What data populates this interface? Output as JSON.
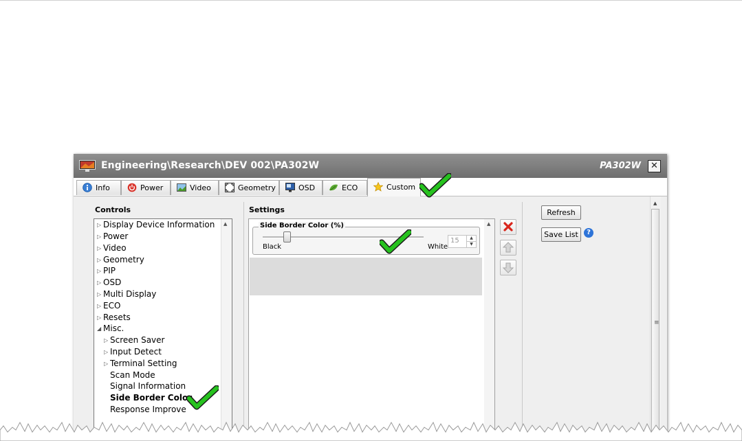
{
  "window": {
    "title": "Engineering\\Research\\DEV 002\\PA302W",
    "model": "PA302W",
    "close_glyph": "✕"
  },
  "tabs": [
    {
      "label": "Info",
      "icon": "info-icon"
    },
    {
      "label": "Power",
      "icon": "power-icon"
    },
    {
      "label": "Video",
      "icon": "video-icon"
    },
    {
      "label": "Geometry",
      "icon": "geometry-icon"
    },
    {
      "label": "OSD",
      "icon": "osd-icon"
    },
    {
      "label": "ECO",
      "icon": "eco-leaf-icon"
    },
    {
      "label": "Custom",
      "icon": "star-icon",
      "active": true
    }
  ],
  "controls": {
    "heading": "Controls",
    "items": [
      {
        "label": "Display Device Information",
        "expander": "collapsed"
      },
      {
        "label": "Power",
        "expander": "collapsed"
      },
      {
        "label": "Video",
        "expander": "collapsed"
      },
      {
        "label": "Geometry",
        "expander": "collapsed"
      },
      {
        "label": "PIP",
        "expander": "collapsed"
      },
      {
        "label": "OSD",
        "expander": "collapsed"
      },
      {
        "label": "Multi Display",
        "expander": "collapsed"
      },
      {
        "label": "ECO",
        "expander": "collapsed"
      },
      {
        "label": "Resets",
        "expander": "collapsed"
      },
      {
        "label": "Misc.",
        "expander": "expanded"
      },
      {
        "label": "Screen Saver",
        "expander": "collapsed",
        "child": true
      },
      {
        "label": "Input Detect",
        "expander": "collapsed",
        "child": true
      },
      {
        "label": "Terminal Setting",
        "expander": "collapsed",
        "child": true
      },
      {
        "label": "Scan Mode",
        "child": true
      },
      {
        "label": "Signal Information",
        "child": true
      },
      {
        "label": "Side Border Color",
        "child": true,
        "selected": true
      },
      {
        "label": "Response Improve",
        "child": true
      }
    ]
  },
  "settings": {
    "heading": "Settings",
    "setting_title": "Side Border Color (%)",
    "min_label": "Black",
    "max_label": "White",
    "value": "15",
    "slider_fraction": 0.15
  },
  "actions": {
    "refresh_label": "Refresh",
    "save_list_label": "Save List",
    "help_glyph": "?"
  },
  "colors": {
    "titlebar": "#7a7a7a",
    "check_green": "#27c21f",
    "delete_red": "#d9261c",
    "help_blue": "#2e74d8"
  }
}
